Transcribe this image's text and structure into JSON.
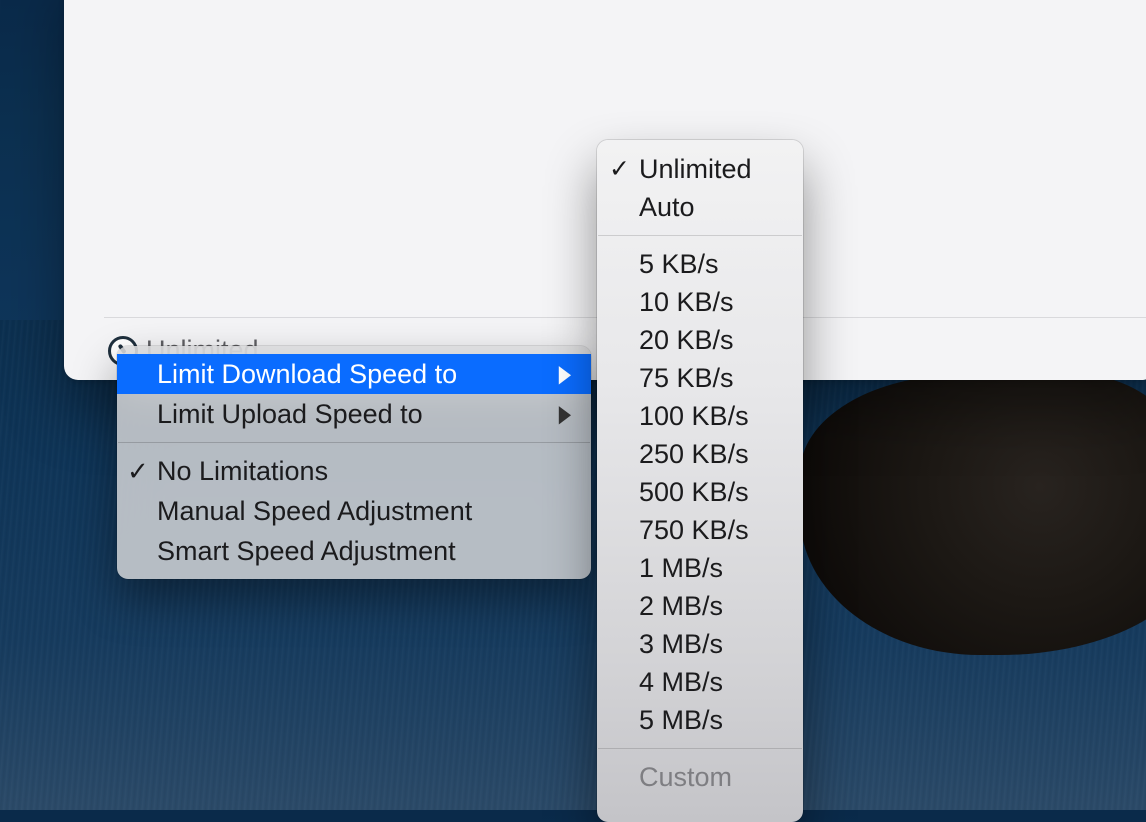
{
  "status": {
    "label": "Unlimited"
  },
  "menu": {
    "items": [
      {
        "label": "Limit Download Speed to",
        "hasSubmenu": true,
        "highlighted": true,
        "checked": false
      },
      {
        "label": "Limit Upload Speed to",
        "hasSubmenu": true,
        "highlighted": false,
        "checked": false
      }
    ],
    "modeItems": [
      {
        "label": "No Limitations",
        "checked": true
      },
      {
        "label": "Manual Speed Adjustment",
        "checked": false
      },
      {
        "label": "Smart Speed Adjustment",
        "checked": false
      }
    ]
  },
  "submenu": {
    "topItems": [
      {
        "label": "Unlimited",
        "checked": true
      },
      {
        "label": "Auto",
        "checked": false
      }
    ],
    "speedItems": [
      {
        "label": "5 KB/s"
      },
      {
        "label": "10 KB/s"
      },
      {
        "label": "20 KB/s"
      },
      {
        "label": "75 KB/s"
      },
      {
        "label": "100 KB/s"
      },
      {
        "label": "250 KB/s"
      },
      {
        "label": "500 KB/s"
      },
      {
        "label": "750 KB/s"
      },
      {
        "label": "1 MB/s"
      },
      {
        "label": "2 MB/s"
      },
      {
        "label": "3 MB/s"
      },
      {
        "label": "4 MB/s"
      },
      {
        "label": "5 MB/s"
      }
    ],
    "customLabel": "Custom"
  }
}
